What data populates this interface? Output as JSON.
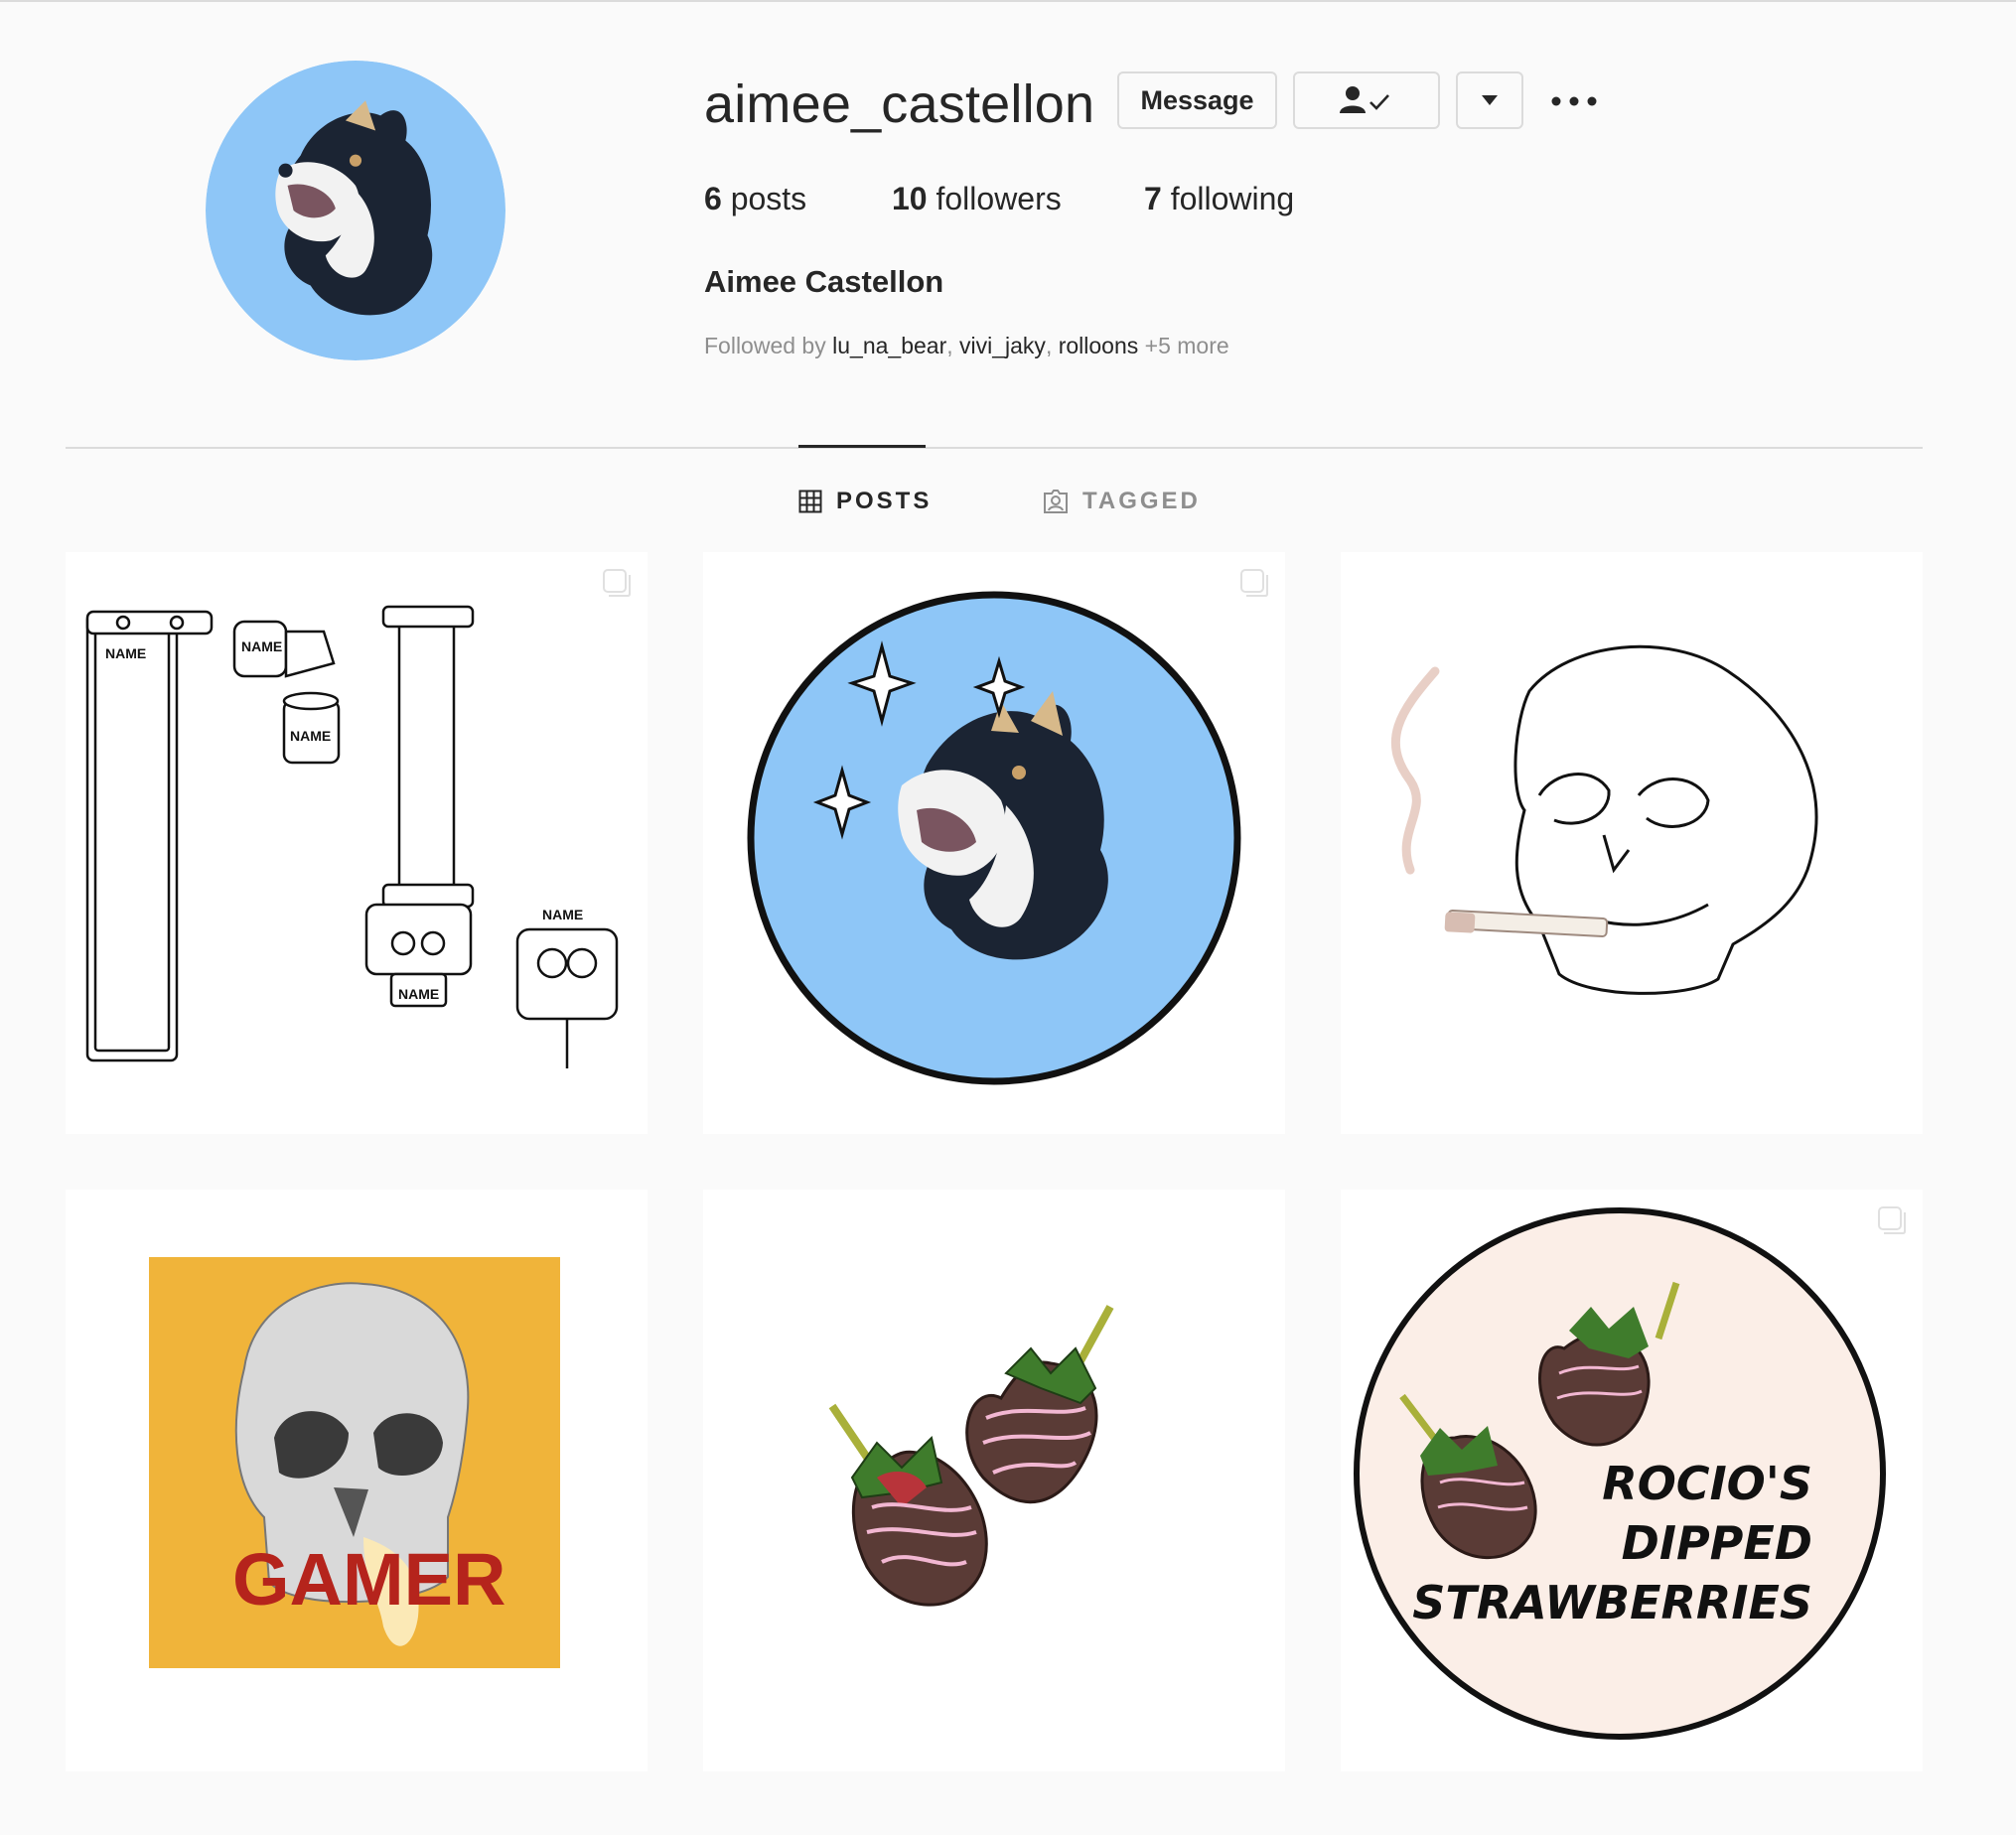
{
  "profile": {
    "username": "aimee_castellon",
    "full_name": "Aimee Castellon",
    "message_label": "Message",
    "stats": {
      "posts_count": "6",
      "posts_label": " posts",
      "followers_count": "10",
      "followers_label": " followers",
      "following_count": "7",
      "following_label": " following"
    },
    "followed_by": {
      "prefix": "Followed by ",
      "accounts": [
        "lu_na_bear",
        "vivi_jaky",
        "rolloons"
      ],
      "more": " +5 more"
    }
  },
  "tabs": [
    {
      "label": "POSTS",
      "active": true
    },
    {
      "label": "TAGGED",
      "active": false
    }
  ],
  "posts": [
    {
      "id": "post-1",
      "art": "line-art water cooling parts",
      "labels": [
        "NAME",
        "NAME",
        "NAME",
        "NAME",
        "NAME"
      ],
      "multiple": true
    },
    {
      "id": "post-2",
      "art": "shiba dog in blue circle",
      "multiple": true
    },
    {
      "id": "post-3",
      "art": "skull smoking cigarette",
      "multiple": false
    },
    {
      "id": "post-4",
      "art": "melting skull on yellow",
      "text": "GAMER",
      "multiple": false
    },
    {
      "id": "post-5",
      "art": "chocolate dipped strawberries",
      "multiple": false
    },
    {
      "id": "post-6",
      "art": "strawberry logo",
      "text_lines": [
        "ROCIO'S",
        "DIPPED",
        "STRAWBERRIES"
      ],
      "multiple": true
    }
  ],
  "colors": {
    "background": "#fafafa",
    "text": "#262626",
    "muted": "#8e8e8e",
    "border": "#dbdbdb",
    "avatar_blue": "#8ec6f7",
    "gamer_yellow": "#f0b43a",
    "gamer_red": "#b5241c"
  },
  "icons": {
    "following": "person-check-icon",
    "dropdown": "caret-down-icon",
    "more": "more-dots-icon",
    "posts_tab": "grid-icon",
    "tagged_tab": "tagged-person-icon",
    "multi": "multiple-photos-icon"
  }
}
